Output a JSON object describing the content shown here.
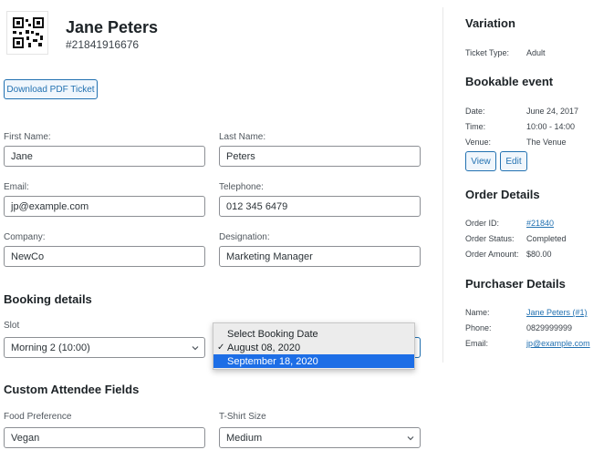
{
  "attendee": {
    "name": "Jane Peters",
    "ticket_id": "#21841916676",
    "download_label": "Download PDF Ticket"
  },
  "form": {
    "first_name": {
      "label": "First Name:",
      "value": "Jane"
    },
    "last_name": {
      "label": "Last Name:",
      "value": "Peters"
    },
    "email": {
      "label": "Email:",
      "value": "jp@example.com"
    },
    "telephone": {
      "label": "Telephone:",
      "value": "012 345 6479"
    },
    "company": {
      "label": "Company:",
      "value": "NewCo"
    },
    "designation": {
      "label": "Designation:",
      "value": "Marketing Manager"
    }
  },
  "booking": {
    "title": "Booking details",
    "slot_label": "Slot",
    "slot_value": "Morning 2 (10:00)",
    "date_options": [
      "Select Booking Date",
      "August 08, 2020",
      "September 18, 2020"
    ],
    "date_checked": "August 08, 2020",
    "date_highlighted": "September 18, 2020"
  },
  "custom": {
    "title": "Custom Attendee Fields",
    "food_label": "Food Preference",
    "food_value": "Vegan",
    "tshirt_label": "T-Shirt Size",
    "tshirt_value": "Medium"
  },
  "sidebar": {
    "variation_title": "Variation",
    "ticket_type_key": "Ticket Type:",
    "ticket_type_val": "Adult",
    "event_title": "Bookable event",
    "date_key": "Date:",
    "date_val": "June 24, 2017",
    "time_key": "Time:",
    "time_val": "10:00 - 14:00",
    "venue_key": "Venue:",
    "venue_val": "The Venue",
    "view_label": "View",
    "edit_label": "Edit",
    "order_title": "Order Details",
    "order_id_key": "Order ID:",
    "order_id_val": "#21840",
    "order_status_key": "Order Status:",
    "order_status_val": "Completed",
    "order_amount_key": "Order Amount:",
    "order_amount_val": "$80.00",
    "purchaser_title": "Purchaser Details",
    "p_name_key": "Name:",
    "p_name_val": "Jane Peters (#1)",
    "p_phone_key": "Phone:",
    "p_phone_val": "0829999999",
    "p_email_key": "Email:",
    "p_email_val": "jp@example.com"
  },
  "colors": {
    "accent": "#2271b1",
    "highlight": "#1d6ee6"
  },
  "icons": [
    "qr-code-icon",
    "chevron-down-icon"
  ]
}
